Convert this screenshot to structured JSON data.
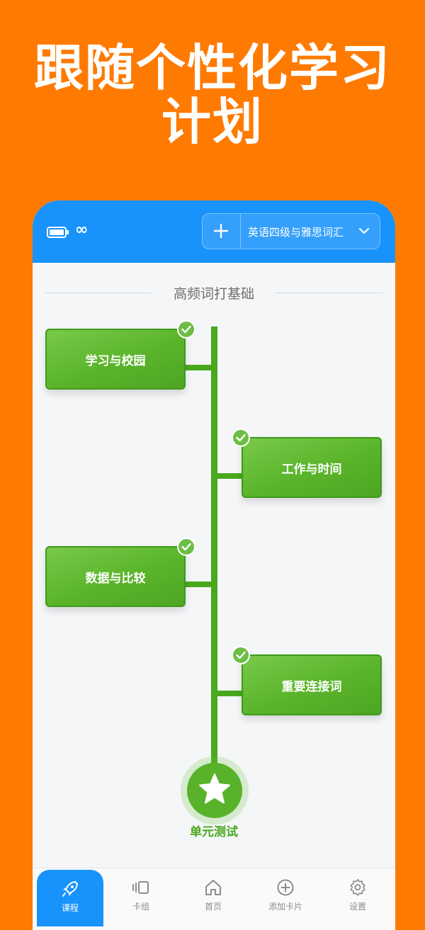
{
  "promo": {
    "line1": "跟随个性化学习",
    "line2": "计划"
  },
  "topbar": {
    "battery_icon": "battery-icon",
    "infinity_text": "∞",
    "add_icon": "plus-icon",
    "book_name": "英语四级与雅思词汇",
    "chevron_icon": "chevron-down-icon"
  },
  "section": {
    "title": "高频词打基础"
  },
  "units": [
    {
      "label": "学习与校园",
      "completed": true
    },
    {
      "label": "工作与时间",
      "completed": true
    },
    {
      "label": "数据与比较",
      "completed": true
    },
    {
      "label": "重要连接词",
      "completed": true
    }
  ],
  "unit_test": {
    "label": "单元测试",
    "icon": "star-icon"
  },
  "tabs": [
    {
      "label": "课程",
      "icon": "rocket-icon",
      "active": true
    },
    {
      "label": "卡组",
      "icon": "cards-icon",
      "active": false
    },
    {
      "label": "首页",
      "icon": "home-icon",
      "active": false
    },
    {
      "label": "添加卡片",
      "icon": "add-circle-icon",
      "active": false
    },
    {
      "label": "设置",
      "icon": "gear-icon",
      "active": false
    }
  ],
  "colors": {
    "background": "#FF7A00",
    "header": "#1893FB",
    "green": "#58B32B",
    "page": "#F4F6F8"
  }
}
